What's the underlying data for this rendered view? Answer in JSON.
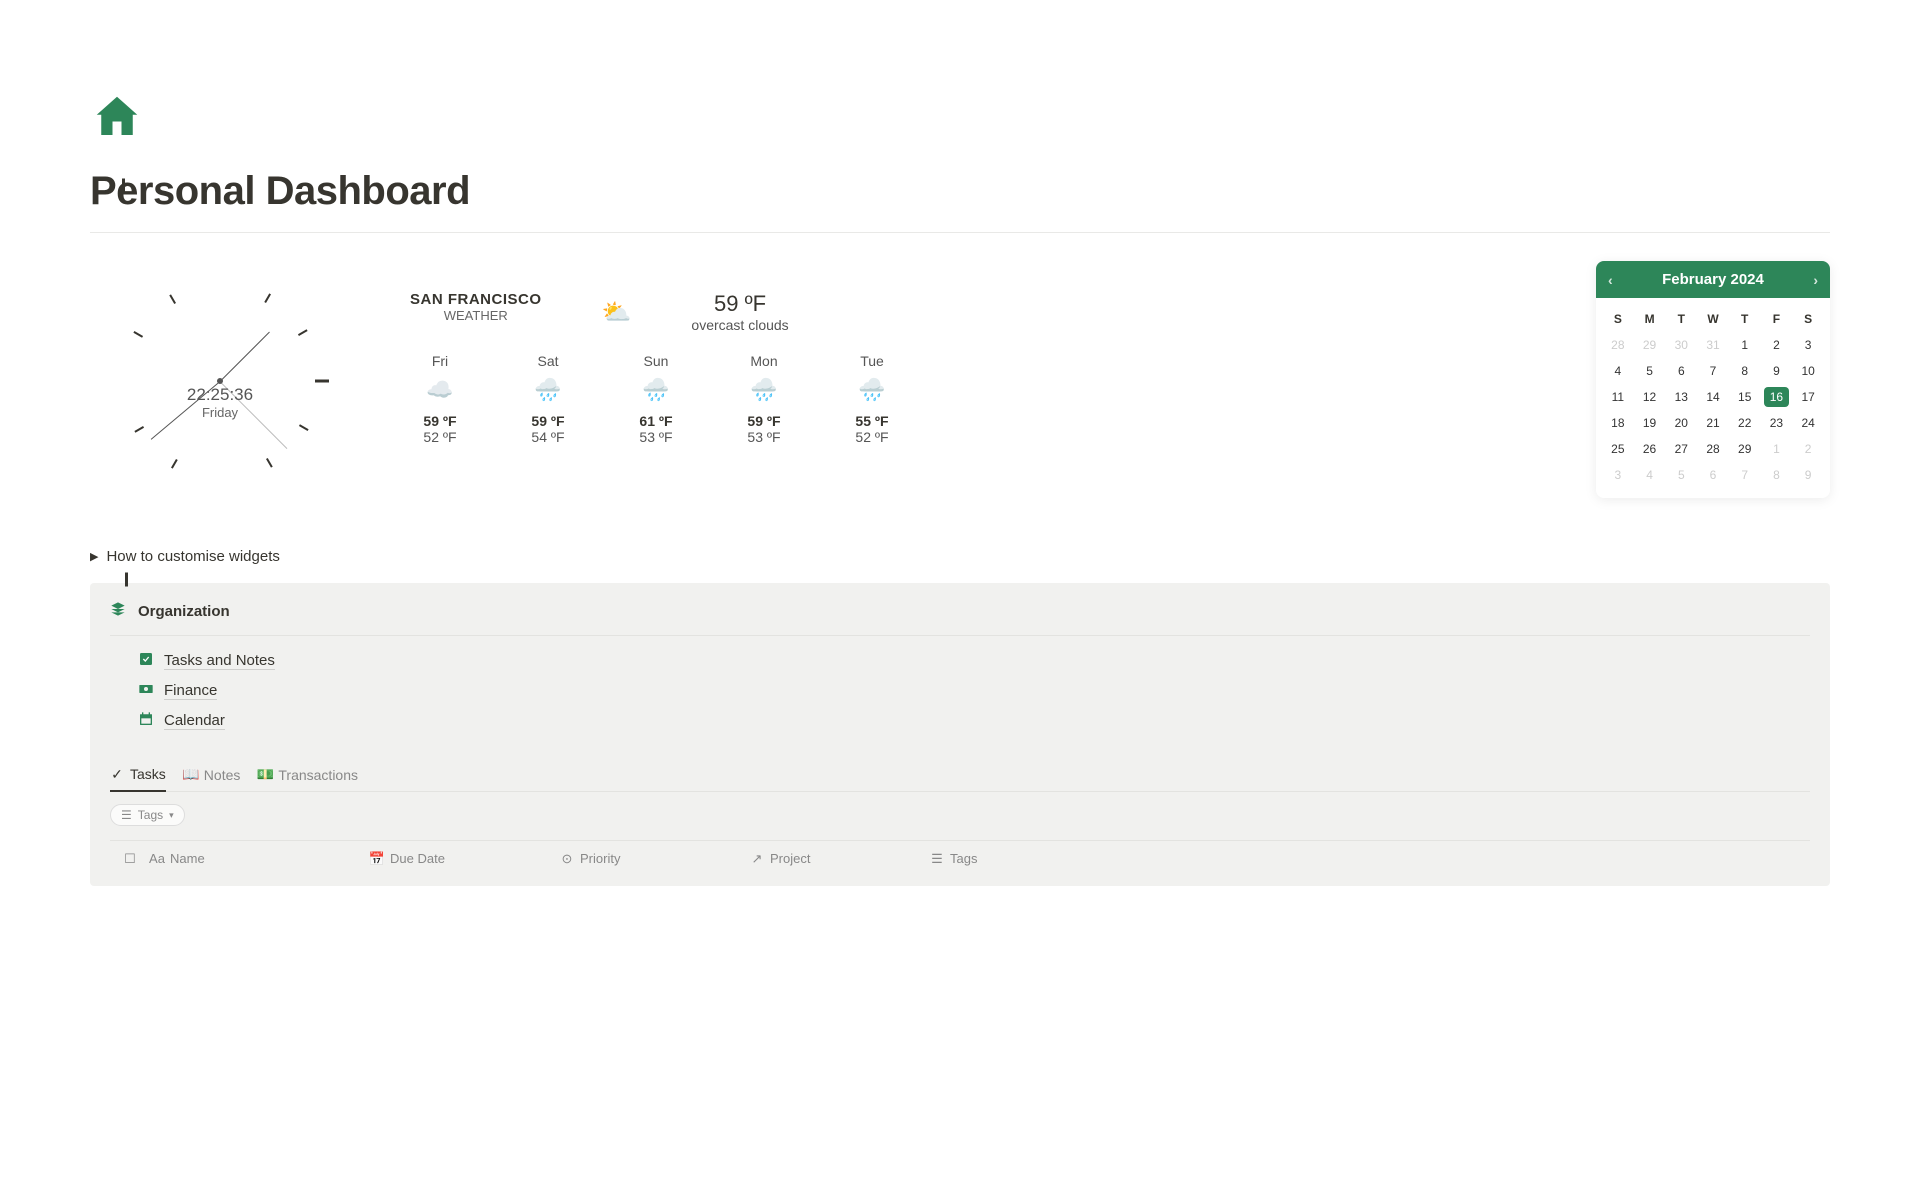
{
  "page": {
    "title": "Personal Dashboard",
    "icon_color": "#2d8659"
  },
  "clock": {
    "time": "22:25:36",
    "day": "Friday"
  },
  "weather": {
    "city": "SAN FRANCISCO",
    "subtitle": "WEATHER",
    "now_temp": "59 ºF",
    "now_cond": "overcast clouds",
    "forecast": [
      {
        "day": "Fri",
        "hi": "59 ºF",
        "lo": "52 ºF",
        "icon": "☁️"
      },
      {
        "day": "Sat",
        "hi": "59 ºF",
        "lo": "54 ºF",
        "icon": "🌧️"
      },
      {
        "day": "Sun",
        "hi": "61 ºF",
        "lo": "53 ºF",
        "icon": "🌧️"
      },
      {
        "day": "Mon",
        "hi": "59 ºF",
        "lo": "53 ºF",
        "icon": "🌧️"
      },
      {
        "day": "Tue",
        "hi": "55 ºF",
        "lo": "52 ºF",
        "icon": "🌧️"
      }
    ]
  },
  "calendar": {
    "month_label": "February 2024",
    "dow": [
      "S",
      "M",
      "T",
      "W",
      "T",
      "F",
      "S"
    ],
    "days": [
      {
        "n": "28",
        "o": true
      },
      {
        "n": "29",
        "o": true
      },
      {
        "n": "30",
        "o": true
      },
      {
        "n": "31",
        "o": true
      },
      {
        "n": "1"
      },
      {
        "n": "2"
      },
      {
        "n": "3"
      },
      {
        "n": "4"
      },
      {
        "n": "5"
      },
      {
        "n": "6"
      },
      {
        "n": "7"
      },
      {
        "n": "8"
      },
      {
        "n": "9"
      },
      {
        "n": "10"
      },
      {
        "n": "11"
      },
      {
        "n": "12"
      },
      {
        "n": "13"
      },
      {
        "n": "14"
      },
      {
        "n": "15"
      },
      {
        "n": "16",
        "t": true
      },
      {
        "n": "17"
      },
      {
        "n": "18"
      },
      {
        "n": "19"
      },
      {
        "n": "20"
      },
      {
        "n": "21"
      },
      {
        "n": "22"
      },
      {
        "n": "23"
      },
      {
        "n": "24"
      },
      {
        "n": "25"
      },
      {
        "n": "26"
      },
      {
        "n": "27"
      },
      {
        "n": "28"
      },
      {
        "n": "29"
      },
      {
        "n": "1",
        "o": true
      },
      {
        "n": "2",
        "o": true
      },
      {
        "n": "3",
        "o": true
      },
      {
        "n": "4",
        "o": true
      },
      {
        "n": "5",
        "o": true
      },
      {
        "n": "6",
        "o": true
      },
      {
        "n": "7",
        "o": true
      },
      {
        "n": "8",
        "o": true
      },
      {
        "n": "9",
        "o": true
      }
    ]
  },
  "toggle": {
    "label": "How to customise widgets"
  },
  "organization": {
    "title": "Organization",
    "links": [
      {
        "label": "Tasks and Notes"
      },
      {
        "label": "Finance"
      },
      {
        "label": "Calendar"
      }
    ]
  },
  "tabs": [
    {
      "label": "Tasks",
      "active": true
    },
    {
      "label": "Notes"
    },
    {
      "label": "Transactions"
    }
  ],
  "filter": {
    "label": "Tags"
  },
  "columns": {
    "name": "Name",
    "due": "Due Date",
    "priority": "Priority",
    "project": "Project",
    "tags": "Tags"
  }
}
